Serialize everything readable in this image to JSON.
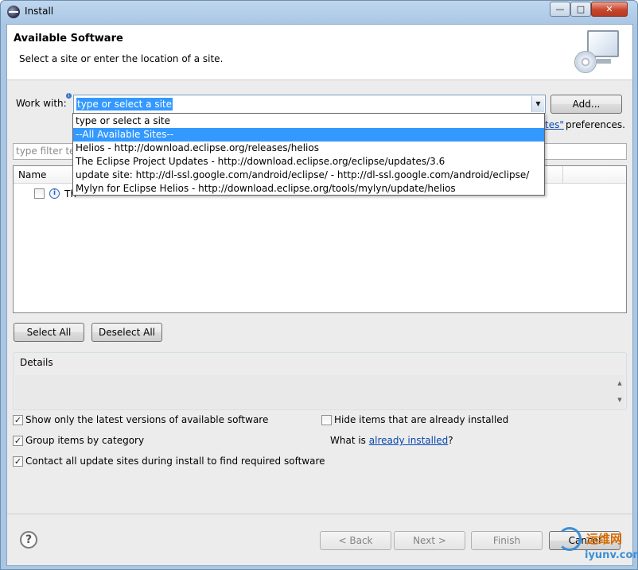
{
  "window": {
    "title": "Install",
    "controls": {
      "minimize": "—",
      "maximize": "□",
      "close": "✕"
    }
  },
  "header": {
    "title": "Available Software",
    "description": "Select a site or enter the location of a site.",
    "graphic_icon": "install-monitor-cd-icon"
  },
  "work_with": {
    "label": "Work with:",
    "info_marker": "i",
    "value": "type or select a site",
    "add_button": "Add...",
    "preferences_link_fragment": "tes\"",
    "preferences_tail": "preferences.",
    "options": [
      "type or select a site",
      "--All Available Sites--",
      "Helios - http://download.eclipse.org/releases/helios",
      "The Eclipse Project Updates - http://download.eclipse.org/eclipse/updates/3.6",
      "update site: http://dl-ssl.google.com/android/eclipse/ - http://dl-ssl.google.com/android/eclipse/",
      "Mylyn for Eclipse Helios - http://download.eclipse.org/tools/mylyn/update/helios"
    ],
    "highlighted_index": 1
  },
  "filter": {
    "placeholder": "type filter tex"
  },
  "tree": {
    "columns": [
      "Name"
    ],
    "rows": [
      {
        "checked": false,
        "text": "Th"
      }
    ]
  },
  "buttons": {
    "select_all": "Select All",
    "deselect_all": "Deselect All"
  },
  "details": {
    "legend": "Details"
  },
  "options": {
    "show_latest": {
      "label": "Show only the latest versions of available software",
      "checked": true
    },
    "hide_installed": {
      "label": "Hide items that are already installed",
      "checked": false
    },
    "group_by_category": {
      "label": "Group items by category",
      "checked": true
    },
    "what_is_prefix": "What is ",
    "what_is_link": "already installed",
    "what_is_suffix": "?",
    "contact_sites": {
      "label": "Contact all update sites during install to find required software",
      "checked": true
    }
  },
  "footer": {
    "help": "?",
    "back": "< Back",
    "next": "Next >",
    "finish": "Finish",
    "cancel": "Cancel"
  },
  "watermark": {
    "line1": "运维网",
    "line2": "iyunv.com"
  },
  "colors": {
    "selection": "#3399ff",
    "link": "#0645ad",
    "window_frame": "#a9c6e4"
  }
}
